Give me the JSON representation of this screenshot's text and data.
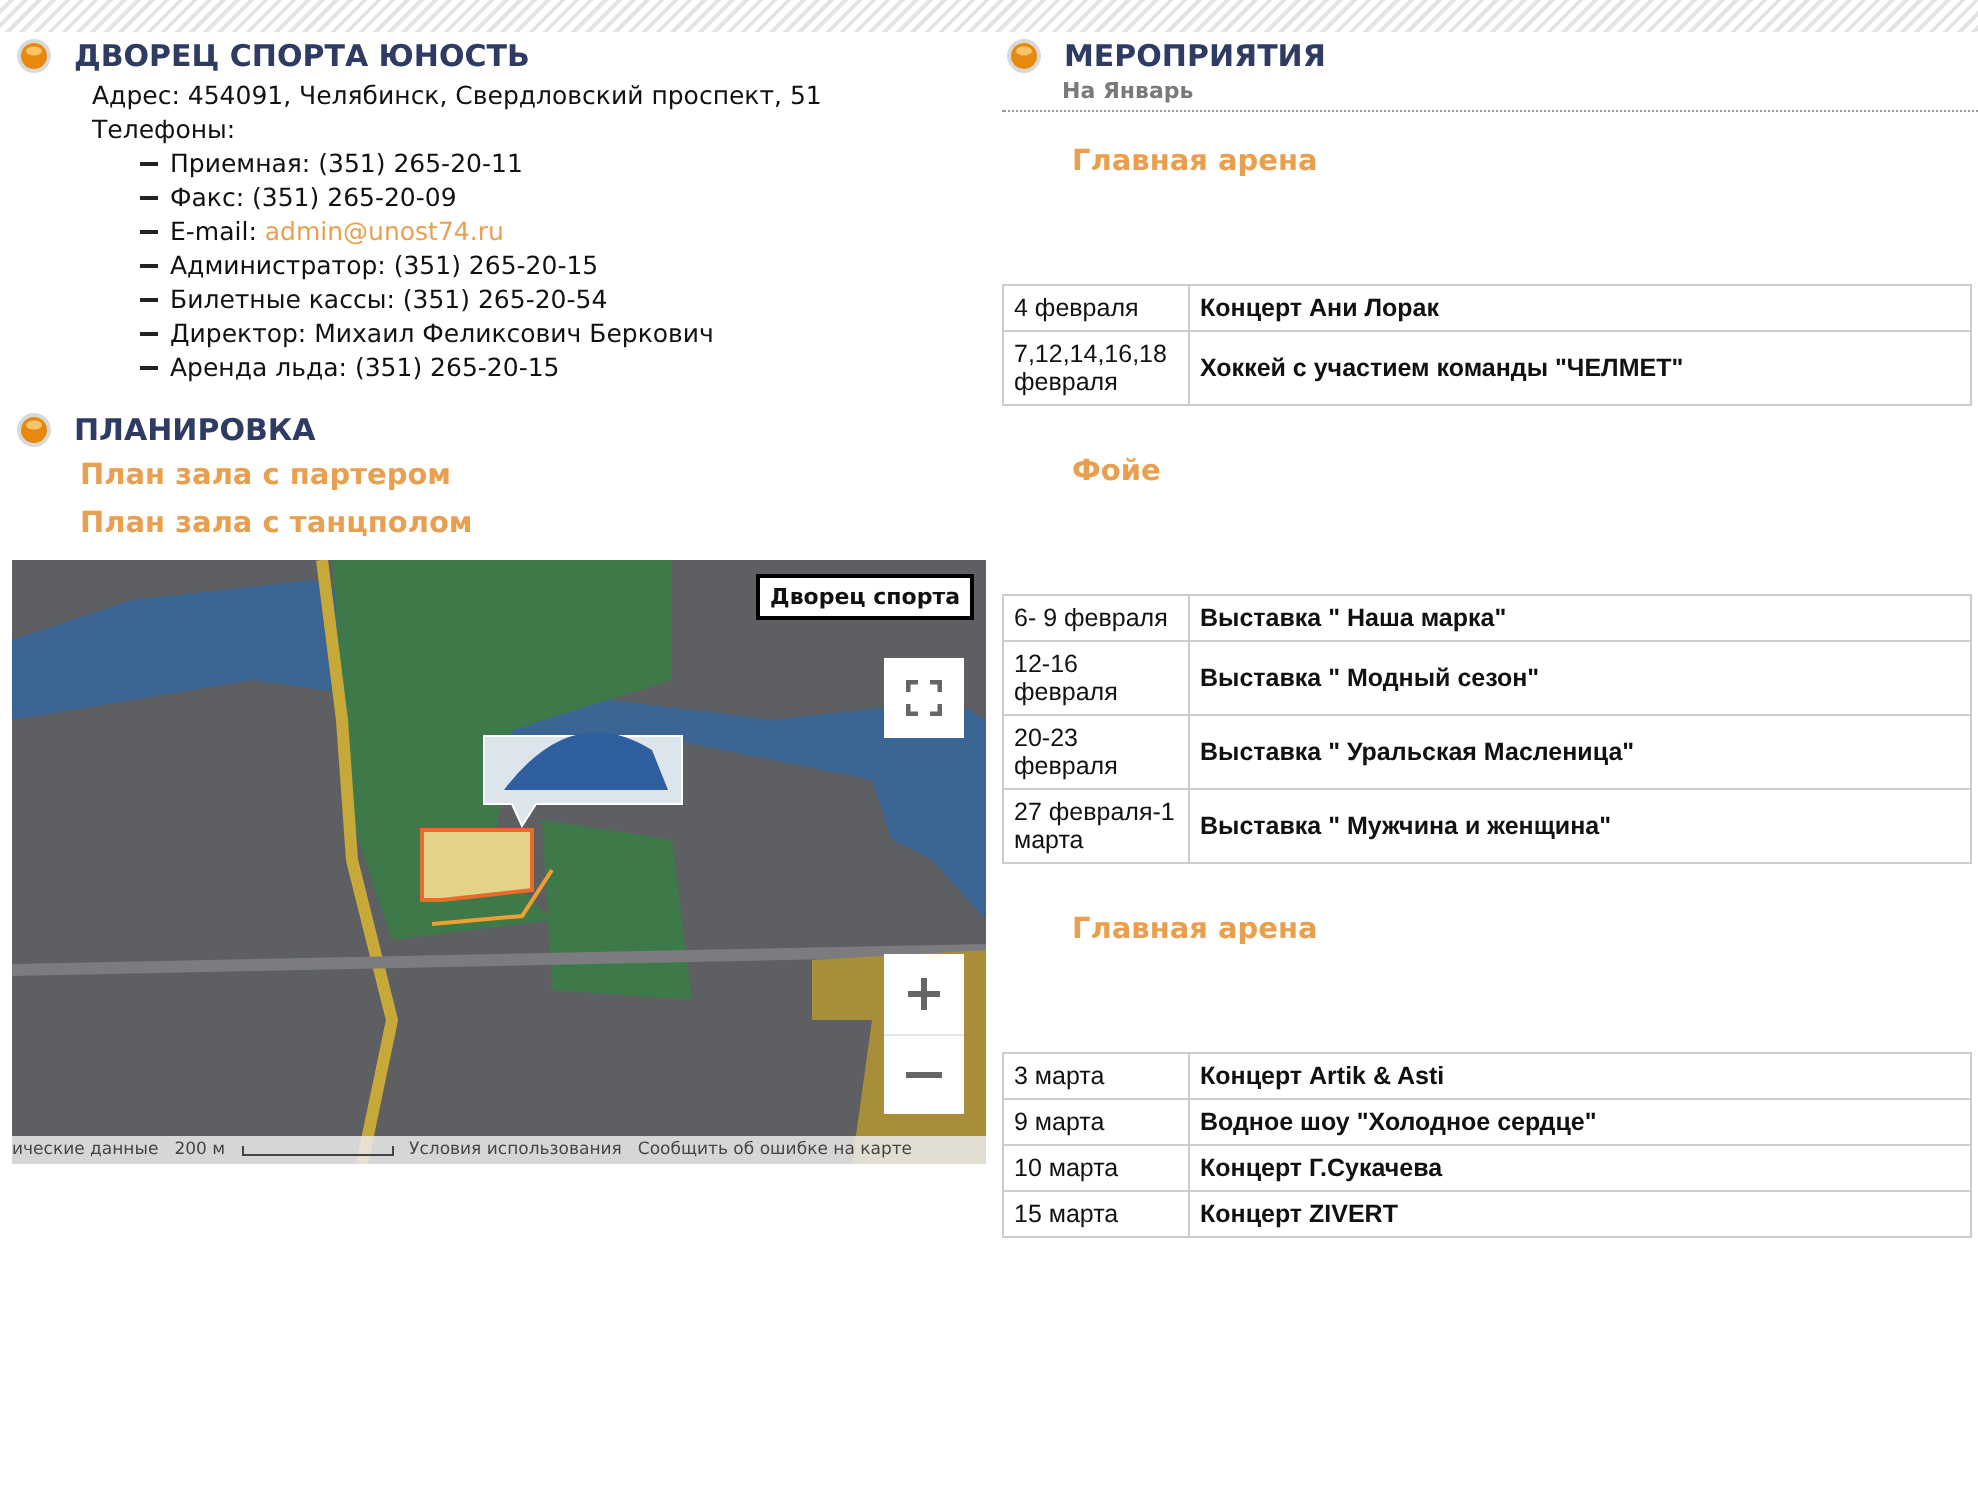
{
  "venue": {
    "title": "ДВОРЕЦ СПОРТА ЮНОСТЬ",
    "address": "Адрес: 454091, Челябинск, Свердловский проспект, 51",
    "phones_label": "Телефоны:",
    "contacts": [
      {
        "kind": "text",
        "text": "Приемная: (351) 265-20-11"
      },
      {
        "kind": "text",
        "text": "Факс: (351) 265-20-09"
      },
      {
        "kind": "email",
        "label": "E-mail: ",
        "link": "admin@unost74.ru"
      },
      {
        "kind": "text",
        "text": "Администратор: (351) 265-20-15"
      },
      {
        "kind": "text",
        "text": "Билетные кассы: (351) 265-20-54"
      },
      {
        "kind": "text",
        "text": "Директор: Михаил Феликсович Беркович"
      },
      {
        "kind": "text",
        "text": "Аренда льда: (351) 265-20-15"
      }
    ]
  },
  "layout": {
    "title": "ПЛАНИРОВКА",
    "links": [
      "План зала с партером",
      "План зала с танцполом"
    ]
  },
  "map": {
    "place_label": "Дворец спорта",
    "attribution": [
      "ические данные",
      "200 м",
      "Условия использования",
      "Сообщить об ошибке на карте"
    ]
  },
  "events": {
    "title": "МЕРОПРИЯТИЯ",
    "subtitle": "На Январь",
    "sections": [
      {
        "venue": "Главная арена",
        "rows": [
          {
            "date": "4 февраля",
            "name": "Концерт Ани Лорак"
          },
          {
            "date": "7,12,14,16,18 февраля",
            "name": "Хоккей с участием команды \"ЧЕЛМЕТ\""
          }
        ]
      },
      {
        "venue": "Фойе",
        "rows": [
          {
            "date": "6- 9 февраля",
            "name": "Выставка \" Наша марка\""
          },
          {
            "date": "12-16 февраля",
            "name": "Выставка \" Модный сезон\""
          },
          {
            "date": "20-23 февраля",
            "name": "Выставка \" Уральская Масленица\""
          },
          {
            "date": "27 февраля-1 марта",
            "name": "Выставка \" Мужчина и женщина\""
          }
        ]
      },
      {
        "venue": "Главная арена",
        "rows": [
          {
            "date": "3 марта",
            "name": "Концерт Artik & Asti"
          },
          {
            "date": "9 марта",
            "name": "Водное шоу \"Холодное сердце\""
          },
          {
            "date": "10 марта",
            "name": "Концерт Г.Сукачева"
          },
          {
            "date": "15 марта",
            "name": "Концерт ZIVERT"
          }
        ]
      }
    ]
  }
}
